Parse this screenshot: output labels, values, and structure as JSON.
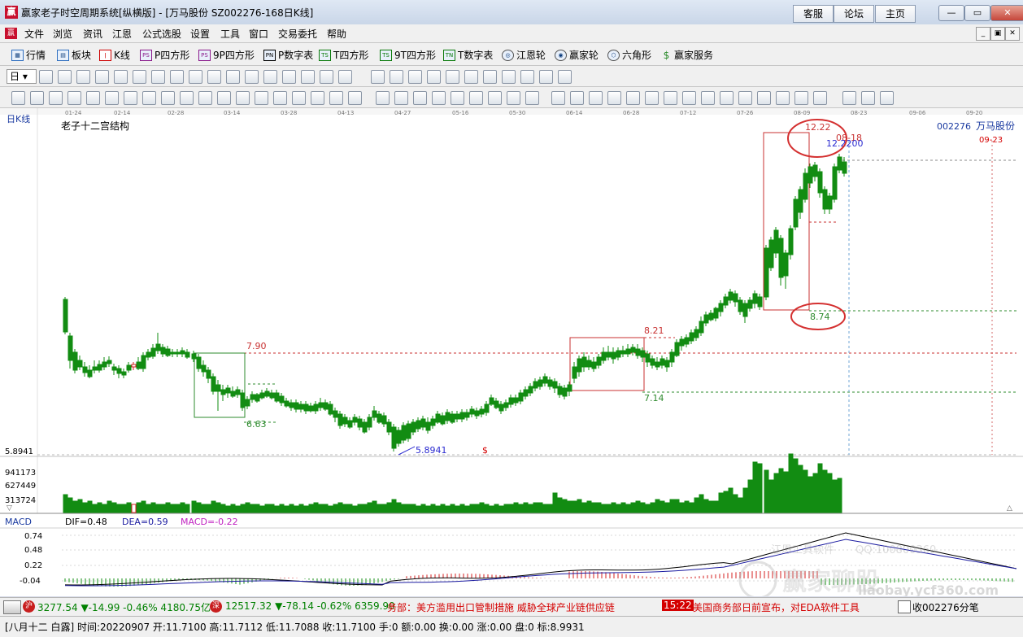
{
  "window": {
    "title": "赢家老子时空周期系统[纵横版] - [万马股份   SZ002276-168日K线]",
    "app_icon": "赢",
    "buttons": [
      "客服",
      "论坛",
      "主页"
    ],
    "controls": [
      "—",
      "▭",
      "✕"
    ]
  },
  "menu": {
    "items": [
      "文件",
      "浏览",
      "资讯",
      "江恩",
      "公式选股",
      "设置",
      "工具",
      "窗口",
      "交易委托",
      "帮助"
    ],
    "mdi": [
      "_",
      "▣",
      "✕"
    ]
  },
  "toolbar1": {
    "items": [
      {
        "label": "行情",
        "icon": "grid-icon"
      },
      {
        "label": "板块",
        "icon": "blocks-icon"
      },
      {
        "label": "K线",
        "icon": "candle-icon"
      },
      {
        "label": "P四方形",
        "icon": "p-square-icon"
      },
      {
        "label": "9P四方形",
        "icon": "9p-square-icon"
      },
      {
        "label": "P数字表",
        "icon": "p-table-icon"
      },
      {
        "label": "T四方形",
        "icon": "t-square-icon"
      },
      {
        "label": "9T四方形",
        "icon": "9t-square-icon"
      },
      {
        "label": "T数字表",
        "icon": "t-table-icon"
      },
      {
        "label": "江恩轮",
        "icon": "gann-wheel-icon"
      },
      {
        "label": "赢家轮",
        "icon": "winner-wheel-icon"
      },
      {
        "label": "六角形",
        "icon": "hexagon-icon"
      },
      {
        "label": "赢家服务",
        "icon": "dollar-icon"
      }
    ]
  },
  "toolbar2": {
    "period": "日"
  },
  "chart": {
    "type_label": "日K线",
    "indicator_name": "老子十二宫结构",
    "stock_code": "002276",
    "stock_name": "万马股份",
    "date_axis": [
      "01-24",
      "02-14",
      "02-28",
      "03-14",
      "03-28",
      "04-13",
      "04-27",
      "05-16",
      "05-30",
      "06-14",
      "06-28",
      "07-12",
      "07-26",
      "08-09",
      "08-23",
      "09-06",
      "09-20"
    ],
    "right_date": "09-23",
    "annotations": {
      "box1_high": "7.90",
      "box1_low": "6.63",
      "min_label": "5.8941",
      "box2_high": "8.21",
      "box2_low": "7.14",
      "box3_high": "12.22",
      "box3_low": "8.74",
      "recent": "12.2200",
      "date_mark": "08-18",
      "dollar": "$"
    },
    "price_scale_label": "5.8941",
    "volume_scale": [
      "941173",
      "627449",
      "313724"
    ],
    "macd": {
      "name": "MACD",
      "dif": "DIF=0.48",
      "dea": "DEA=0.59",
      "macd": "MACD=-0.22",
      "scale": [
        "0.74",
        "0.48",
        "0.22",
        "-0.04"
      ]
    },
    "watermark": {
      "line1": "江恩工具软件",
      "qq": "QQ:100800360",
      "brand": "赢家聊股",
      "site": "liaobay.ycf360.com"
    },
    "chart_data": {
      "type": "candlestick",
      "title": "老子十二宫结构",
      "x_range": [
        "01-24",
        "09-23"
      ],
      "y_range": [
        5.89,
        12.22
      ],
      "key_levels": [
        7.9,
        6.63,
        5.8941,
        8.21,
        7.14,
        12.22,
        8.74,
        12.22
      ],
      "macd_values": {
        "DIF": 0.48,
        "DEA": 0.59,
        "MACD": -0.22
      }
    }
  },
  "ticker": {
    "sh_label": "沪",
    "sh": "3277.54 ▼-14.99 -0.46% 4180.75亿",
    "sz_label": "深",
    "sz": "12517.32 ▼-78.14 -0.62% 6359.90",
    "news1": "务部：美方滥用出口管制措施 威胁全球产业链供应链",
    "time": "15:22",
    "news2": "美国商务部日前宣布，对EDA软件工具",
    "right": "收002276分笔"
  },
  "status": {
    "text": "[八月十二 白露] 时间:20220907 开:11.7100 高:11.7112 低:11.7088 收:11.7100 手:0 额:0.00 换:0.00 涨:0.00 盘:0 标:8.9931"
  }
}
